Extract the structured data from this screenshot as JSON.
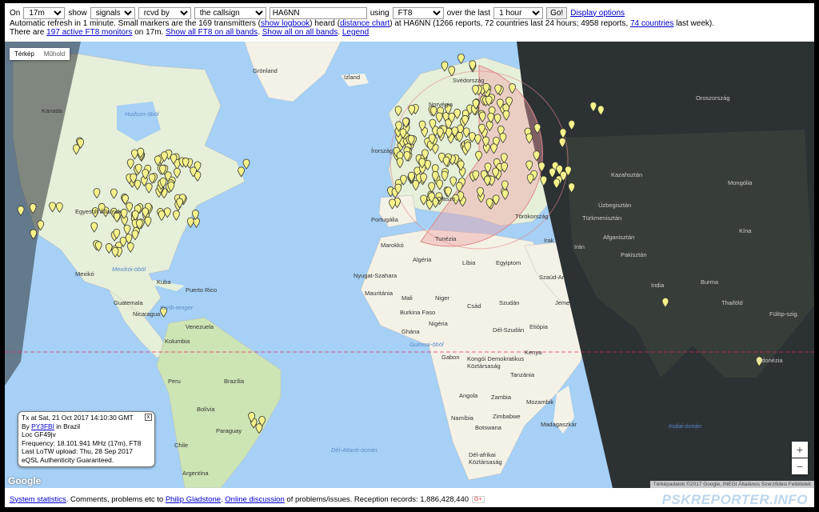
{
  "controls": {
    "on_label": "On",
    "band": "17m",
    "show_label": "show",
    "show_value": "signals",
    "direction": "rcvd by",
    "match": "the callsign",
    "callsign": "HA6NN",
    "using_label": "using",
    "mode": "FT8",
    "over_label": "over the last",
    "period": "1 hour",
    "go_label": "Go!",
    "display_options": "Display options"
  },
  "info": {
    "line1_a": "Automatic refresh in 1 minute. Small markers are the 169 transmitters (",
    "show_logbook": "show logbook",
    "line1_b": ") heard (",
    "distance_chart": "distance chart",
    "line1_c": ") at HA6NN (1266 reports, 72 countries last 24 hours; 4958 reports,",
    "countries_link": "74 countries",
    "line1_d": "last week).",
    "line2_a": "There are",
    "monitors_link": "197 active FT8 monitors",
    "line2_b": "on 17m.",
    "show_all_ft8": "Show all FT8 on all bands",
    "show_all": "Show all on all bands",
    "legend": "Legend"
  },
  "map": {
    "type_map": "Térkép",
    "type_sat": "Műhold",
    "zoom_in": "+",
    "zoom_out": "−",
    "google": "Google",
    "credits": "Térképadatok ©2017 Google, INEGI   Általános Szerződési Feltételek",
    "labels": {
      "kanada": "Kanada",
      "gronland": "Grönland",
      "izland": "Izland",
      "hudson": "Hudson-öböl",
      "egyesult": "Egyesült Államok",
      "mexiko": "Mexikó",
      "mexikoi": "Mexikói-öböl",
      "kuba": "Kuba",
      "puerto": "Puerto Rico",
      "guatemala": "Guatemala",
      "nicaragua": "Nicaragua",
      "karib": "Karib-tenger",
      "venezuela": "Venezuela",
      "kolumbia": "Kolumbia",
      "peru": "Peru",
      "brazilia": "Brazília",
      "bolivia": "Bolívia",
      "paraguay": "Paraguay",
      "argentina": "Argentína",
      "chile": "Chile",
      "norvegia": "Norvégia",
      "svedorszag": "Svédország",
      "irorszag": "Írország",
      "portugalia": "Portugália",
      "olasz": "Olaszo.",
      "torokorszag": "Törökország",
      "marokko": "Marokkó",
      "algeria": "Algéria",
      "libia": "Líbia",
      "egyiptom": "Egyiptom",
      "tunezia": "Tunézia",
      "nyugat": "Nyugat-Szahara",
      "mauritania": "Mauritánia",
      "mali": "Mali",
      "niger": "Niger",
      "csad": "Csád",
      "szudan": "Szudán",
      "nigeria": "Nigéria",
      "burkina": "Burkina Faso",
      "ghana": "Ghána",
      "guinea": "Guineai-öböl",
      "gabon": "Gabon",
      "kongo": "Kongói Demokratikus Köztársaság",
      "del_szudan": "Dél-Szudán",
      "etiopia": "Etiópia",
      "kenya": "Kenya",
      "tanzania": "Tanzánia",
      "angola": "Angola",
      "zambia": "Zambia",
      "namibia": "Namíbia",
      "zimbabwe": "Zimbabwe",
      "botswana": "Botswana",
      "mozambik": "Mozambik",
      "madagaszkar": "Madagaszkár",
      "del_afrikai": "Dél-afrikai Köztársaság",
      "del_atlanti": "Dél-Atlanti-óceán",
      "szaud": "Szaúd-Arábia",
      "jemen": "Jemen",
      "irak": "Irak",
      "iran": "Irán",
      "oroszorszag": "Oroszország",
      "kazahsztan": "Kazahsztán",
      "mongolia": "Mongólia",
      "uzbegisztan": "Üzbegisztán",
      "turkmenisztan": "Türkmenisztán",
      "afganisztan": "Afganisztán",
      "pakisztan": "Pakisztán",
      "india": "India",
      "burma": "Burma",
      "kina": "Kína",
      "thaifold": "Thaiföld",
      "fulop": "Fülöp-szig.",
      "indonezia": "Indonézia",
      "indiai": "Indiai-óceán"
    }
  },
  "popup": {
    "line1": "Tx at Sat, 21 Oct 2017 14:10:30 GMT",
    "by_label": "By",
    "callsign": "PY3FBI",
    "in_label": "in Brazil",
    "loc": "Loc GF49jv",
    "frequency": "Frequency: 18.101.941 MHz (17m), FT8",
    "lotw": "Last LoTW upload: Thu, 28 Sep 2017",
    "eqsl": "eQSL Authenticity Guaranteed.",
    "close": "x"
  },
  "footer": {
    "stats": "System statistics",
    "text_a": ". Comments, problems etc to",
    "author": "Philip Gladstone",
    "text_b": ".",
    "discussion": "Online discussion",
    "text_c": "of problems/issues. Reception records: 1,886,428,440",
    "gplus": "G+",
    "brand": "PSKREPORTER.INFO"
  },
  "colors": {
    "ocean": "#a6d0f5",
    "land": "#f4f1e6",
    "forest": "#cde4b4",
    "night": "#2c3134",
    "marker": "#f5f28a",
    "range_circle": "#f0a0a8",
    "link": "#0000cc"
  }
}
